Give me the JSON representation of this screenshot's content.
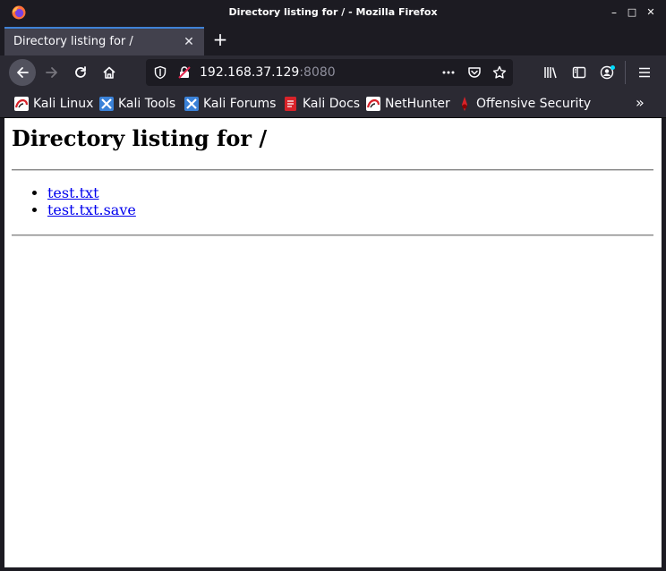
{
  "window": {
    "title": "Directory listing for / - Mozilla Firefox",
    "minimize": "–",
    "maximize": "□",
    "close": "✕"
  },
  "tab": {
    "title": "Directory listing for /",
    "close": "✕",
    "new_tab": "+"
  },
  "url": {
    "host": "192.168.37.129",
    "port": ":8080"
  },
  "bookmarks": [
    {
      "label": "Kali Linux",
      "icon": "kali-dragon-icon"
    },
    {
      "label": "Kali Tools",
      "icon": "kali-tools-icon"
    },
    {
      "label": "Kali Forums",
      "icon": "kali-forums-icon"
    },
    {
      "label": "Kali Docs",
      "icon": "kali-docs-icon"
    },
    {
      "label": "NetHunter",
      "icon": "kali-dragon-icon"
    },
    {
      "label": "Offensive Security",
      "icon": "offsec-icon"
    }
  ],
  "bookmarks_more": "»",
  "page": {
    "heading": "Directory listing for /",
    "files": [
      "test.txt",
      "test.txt.save"
    ]
  },
  "colors": {
    "accent": "#3f82d6",
    "link": "#0000ee",
    "chrome_dark": "#1c1b22",
    "chrome": "#2b2a33"
  }
}
